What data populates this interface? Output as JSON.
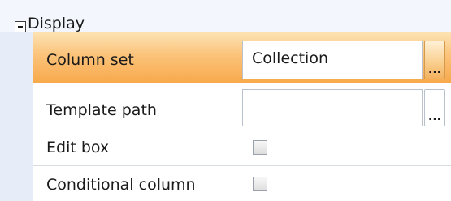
{
  "category": {
    "label": "Display",
    "expanded": true
  },
  "properties": [
    {
      "name": "Column set",
      "type": "text-with-button",
      "value": "Collection",
      "button_label": "...",
      "selected": true
    },
    {
      "name": "Template path",
      "type": "text-with-button",
      "value": "",
      "button_label": "...",
      "selected": false
    },
    {
      "name": "Edit box",
      "type": "checkbox",
      "checked": false
    },
    {
      "name": "Conditional column",
      "type": "checkbox",
      "checked": false
    }
  ],
  "colors": {
    "selected_row_top": "#fde3b3",
    "selected_row_bottom": "#f8a94c",
    "gutter": "#e6edf8",
    "category_background": "#f3f7fd",
    "grid_line": "#d7dce4"
  },
  "icons": {
    "collapse": "minus-square-icon"
  }
}
